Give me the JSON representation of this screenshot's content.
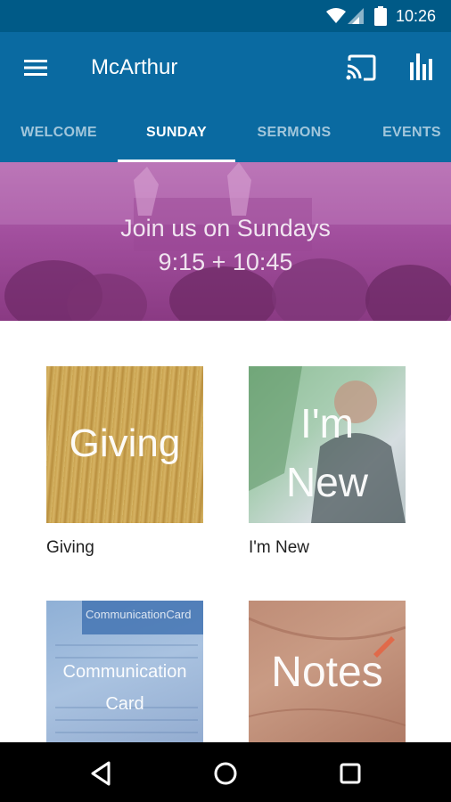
{
  "status_bar": {
    "time": "10:26",
    "icons": [
      "wifi-icon",
      "cellular-signal-icon",
      "battery-icon"
    ]
  },
  "app_bar": {
    "title": "McArthur",
    "actions": [
      "menu-icon",
      "cast-icon",
      "bar-chart-icon"
    ],
    "color": "#0a6aa1"
  },
  "tabs": [
    {
      "label": "WELCOME",
      "active": false
    },
    {
      "label": "SUNDAY",
      "active": true
    },
    {
      "label": "SERMONS",
      "active": false
    },
    {
      "label": "EVENTS",
      "active": false
    }
  ],
  "hero": {
    "line1": "Join us on Sundays",
    "line2": "9:15 + 10:45"
  },
  "tiles": [
    {
      "image_text": "Giving",
      "label": "Giving"
    },
    {
      "image_text_line1": "I'm",
      "image_text_line2": "New",
      "label": "I'm New"
    },
    {
      "image_text_line1": "Communication",
      "image_text_line2": "Card",
      "image_subtext": "CommunicationCard",
      "label": ""
    },
    {
      "image_text": "Notes",
      "label": ""
    }
  ],
  "nav_bar": {
    "buttons": [
      "back-icon",
      "home-icon",
      "recents-icon"
    ]
  }
}
